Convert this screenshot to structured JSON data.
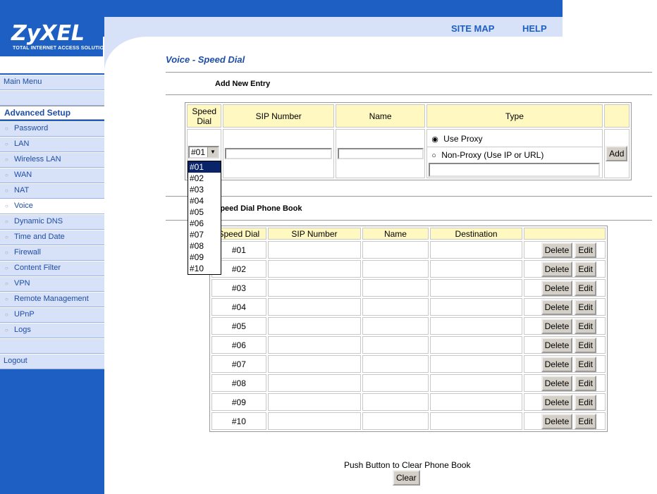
{
  "brand": {
    "name": "ZyXEL",
    "tagline": "Total Internet Access Solution"
  },
  "toplinks": {
    "sitemap": "SITE MAP",
    "help": "HELP"
  },
  "sidebar": {
    "main_menu": "Main Menu",
    "advanced_setup": "Advanced Setup",
    "items": [
      "Password",
      "LAN",
      "Wireless LAN",
      "WAN",
      "NAT",
      "Voice",
      "Dynamic DNS",
      "Time and Date",
      "Firewall",
      "Content Filter",
      "VPN",
      "Remote Management",
      "UPnP",
      "Logs"
    ],
    "logout": "Logout"
  },
  "page": {
    "title": "Voice - Speed Dial",
    "add_section": "Add New Entry",
    "phonebook_section": "Speed Dial Phone Book",
    "clear_text": "Push Button to Clear Phone Book",
    "clear_button": "Clear"
  },
  "add_form": {
    "headers": {
      "speed_dial": "Speed Dial",
      "sip_number": "SIP Number",
      "name": "Name",
      "type": "Type"
    },
    "selected": "#01",
    "options": [
      "#01",
      "#02",
      "#03",
      "#04",
      "#05",
      "#06",
      "#07",
      "#08",
      "#09",
      "#10"
    ],
    "use_proxy": "Use Proxy",
    "non_proxy": "Non-Proxy (Use IP or URL)",
    "add_button": "Add"
  },
  "phonebook": {
    "headers": {
      "speed_dial": "Speed Dial",
      "sip_number": "SIP Number",
      "name": "Name",
      "destination": "Destination"
    },
    "rows": [
      "#01",
      "#02",
      "#03",
      "#04",
      "#05",
      "#06",
      "#07",
      "#08",
      "#09",
      "#10"
    ],
    "delete_label": "Delete",
    "edit_label": "Edit"
  }
}
